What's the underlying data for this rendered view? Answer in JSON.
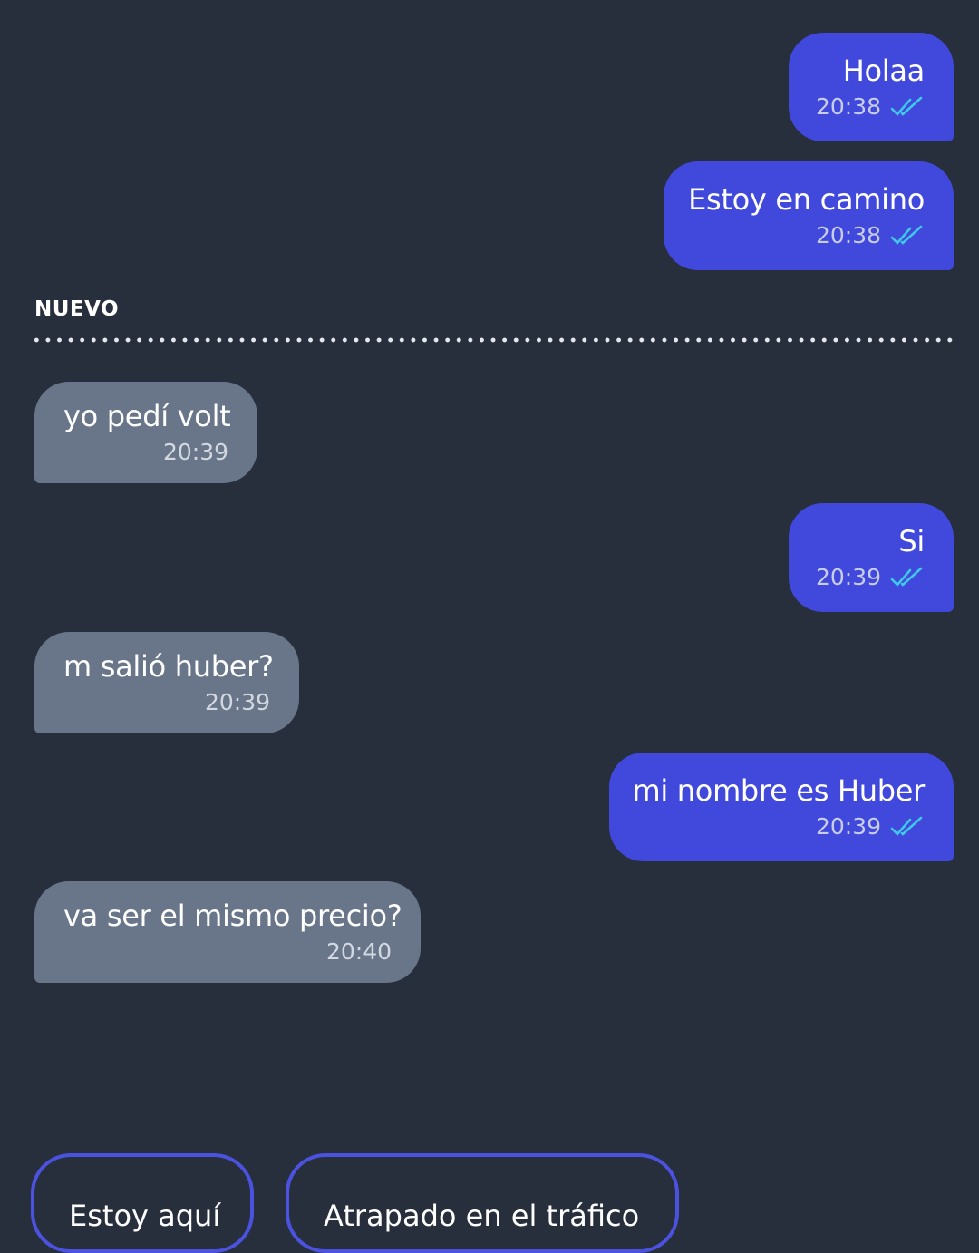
{
  "messages": [
    {
      "text": "Holaa",
      "time": "20:38",
      "direction": "out",
      "status": "read"
    },
    {
      "text": "Estoy en camino",
      "time": "20:38",
      "direction": "out",
      "status": "read"
    },
    {
      "text": "yo pedí volt",
      "time": "20:39",
      "direction": "in"
    },
    {
      "text": "Si",
      "time": "20:39",
      "direction": "out",
      "status": "read"
    },
    {
      "text": "m salió huber?",
      "time": "20:39",
      "direction": "in"
    },
    {
      "text": "mi nombre es Huber",
      "time": "20:39",
      "direction": "out",
      "status": "read"
    },
    {
      "text": "va ser el mismo precio?",
      "time": "20:40",
      "direction": "in"
    }
  ],
  "divider": {
    "label": "NUEVO"
  },
  "quick_replies": [
    "Estoy aquí",
    "Atrapado en el tráfico"
  ],
  "colors": {
    "background": "#272f3d",
    "outgoing_bubble": "#4149dd",
    "incoming_bubble": "#69768a",
    "read_ticks": "#3fc8e8",
    "quick_reply_border": "#4b52e0"
  },
  "icons": {
    "read_status": "double-check-icon"
  }
}
